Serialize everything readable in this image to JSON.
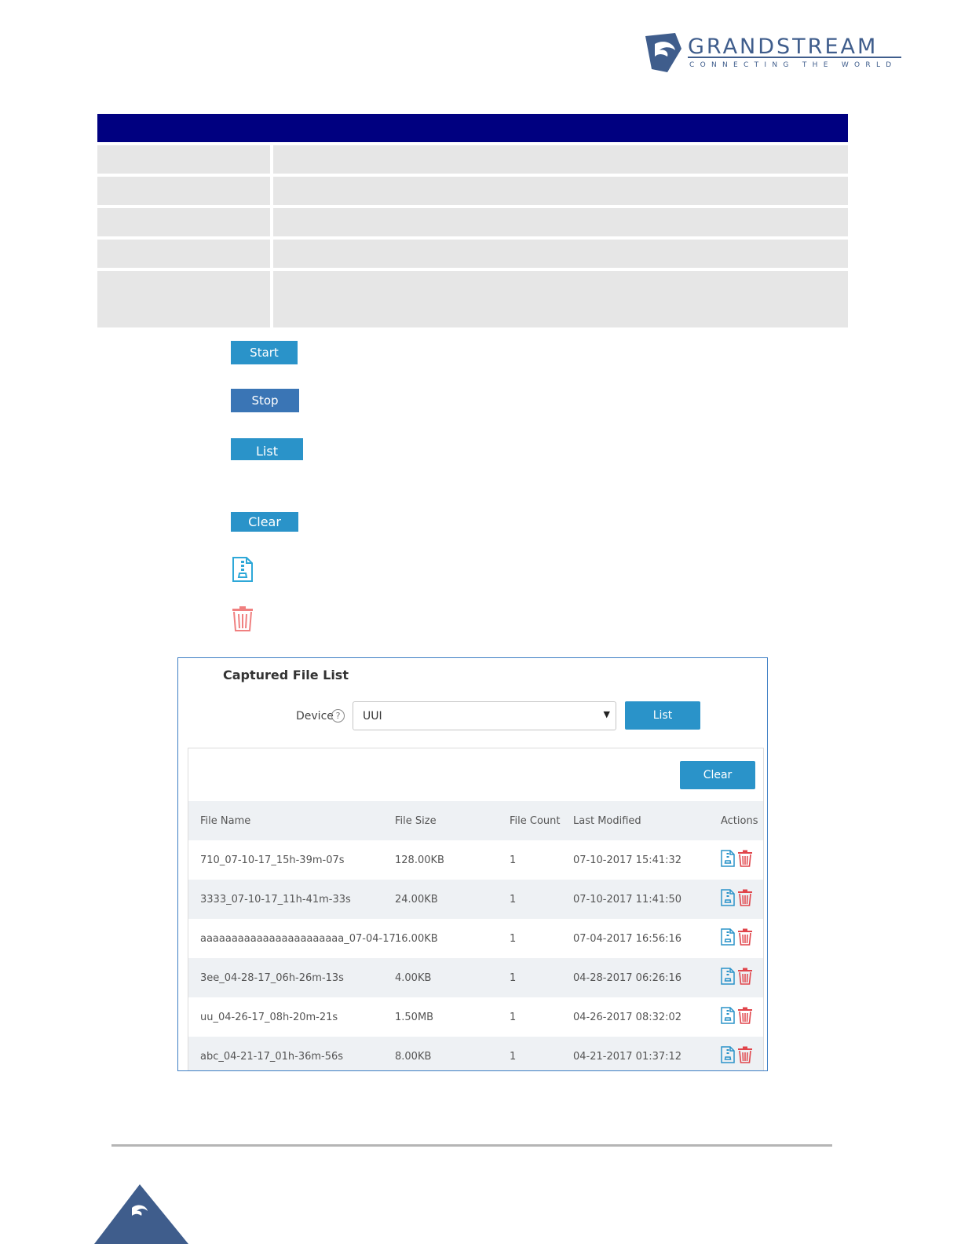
{
  "logo": {
    "brand": "GRANDSTREAM",
    "tagline": "CONNECTING THE WORLD"
  },
  "buttons": {
    "start": "Start",
    "stop": "Stop",
    "list": "List",
    "clear": "Clear"
  },
  "icons": {
    "download": "download-file-icon",
    "delete": "trash-icon"
  },
  "panel": {
    "title": "Captured File List",
    "device_label": "Device",
    "help_glyph": "?",
    "device_value": "UUI",
    "list_button": "List",
    "clear_button": "Clear",
    "columns": [
      "File Name",
      "File Size",
      "File Count",
      "Last Modified",
      "Actions"
    ],
    "rows": [
      {
        "name": "710_07-10-17_15h-39m-07s",
        "size": "128.00KB",
        "count": "1",
        "modified": "07-10-2017 15:41:32"
      },
      {
        "name": "3333_07-10-17_11h-41m-33s",
        "size": "24.00KB",
        "count": "1",
        "modified": "07-10-2017 11:41:50"
      },
      {
        "name": "aaaaaaaaaaaaaaaaaaaaaaa_07-04-17_...",
        "size": "16.00KB",
        "count": "1",
        "modified": "07-04-2017 16:56:16"
      },
      {
        "name": "3ee_04-28-17_06h-26m-13s",
        "size": "4.00KB",
        "count": "1",
        "modified": "04-28-2017 06:26:16"
      },
      {
        "name": "uu_04-26-17_08h-20m-21s",
        "size": "1.50MB",
        "count": "1",
        "modified": "04-26-2017 08:32:02"
      },
      {
        "name": "abc_04-21-17_01h-36m-56s",
        "size": "8.00KB",
        "count": "1",
        "modified": "04-21-2017 01:37:12"
      }
    ]
  },
  "colors": {
    "header_bar": "#000080",
    "button_blue": "#2a93c9",
    "brand_blue": "#3f5d8c",
    "delete_red": "#e0454b"
  }
}
